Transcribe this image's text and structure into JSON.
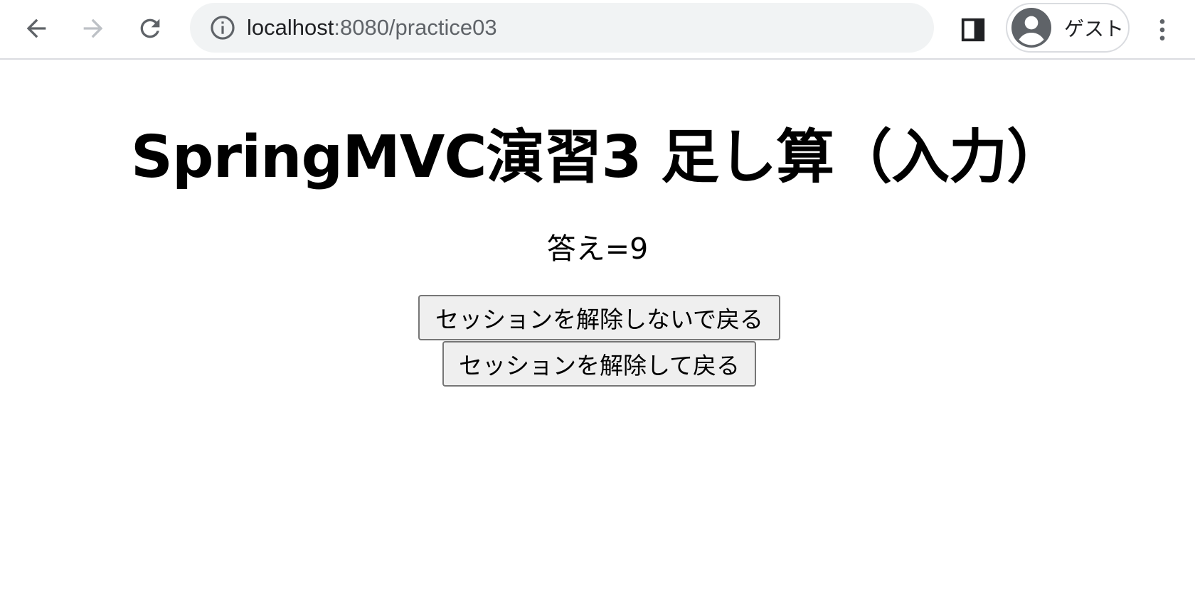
{
  "browser": {
    "url_host": "localhost",
    "url_rest": ":8080/practice03",
    "profile_label": "ゲスト",
    "icons": {
      "back": "back-arrow-icon",
      "forward": "forward-arrow-icon",
      "reload": "reload-icon",
      "site_info": "info-icon",
      "side_panel": "side-panel-icon",
      "avatar": "guest-avatar-icon",
      "menu": "kebab-menu-icon"
    },
    "colors": {
      "icon": "#5f6368",
      "icon_disabled": "#bdc1c6",
      "omnibox_bg": "#f1f3f4"
    }
  },
  "page": {
    "title": "SpringMVC演習3 足し算（入力）",
    "answer": "答え=9",
    "buttons": {
      "back_keep_session": "セッションを解除しないで戻る",
      "back_clear_session": "セッションを解除して戻る"
    }
  }
}
